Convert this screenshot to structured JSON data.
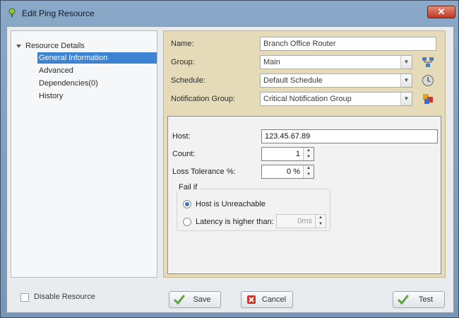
{
  "window": {
    "title": "Edit Ping Resource",
    "close_glyph": "✕"
  },
  "tree": {
    "root": "Resource Details",
    "items": [
      {
        "label": "General Information",
        "selected": true
      },
      {
        "label": "Advanced"
      },
      {
        "label": "Dependencies(0)"
      },
      {
        "label": "History"
      }
    ]
  },
  "general": {
    "name_label": "Name:",
    "name_value": "Branch Office Router",
    "group_label": "Group:",
    "group_value": "Main",
    "schedule_label": "Schedule:",
    "schedule_value": "Default Schedule",
    "notif_label": "Notification Group:",
    "notif_value": "Critical Notification Group",
    "icons": [
      "group-tree-icon",
      "schedule-clock-icon",
      "notification-group-icon"
    ]
  },
  "ping": {
    "host_label": "Host:",
    "host_value": "123.45.67.89",
    "count_label": "Count:",
    "count_value": "1",
    "loss_label": "Loss Tolerance %:",
    "loss_value": "0 %",
    "failif_title": "Fail if",
    "option_unreachable": "Host is Unreachable",
    "option_latency": "Latency is higher than:",
    "latency_value": "0ms",
    "selected_option": "unreachable"
  },
  "footer": {
    "disable_label": "Disable Resource",
    "save_label": "Save",
    "cancel_label": "Cancel",
    "test_label": "Test"
  },
  "colors": {
    "accent": "#3c83d4",
    "panel": "#e6dbb8",
    "save_check": "#5aa53a",
    "cancel_red": "#c8382a"
  }
}
